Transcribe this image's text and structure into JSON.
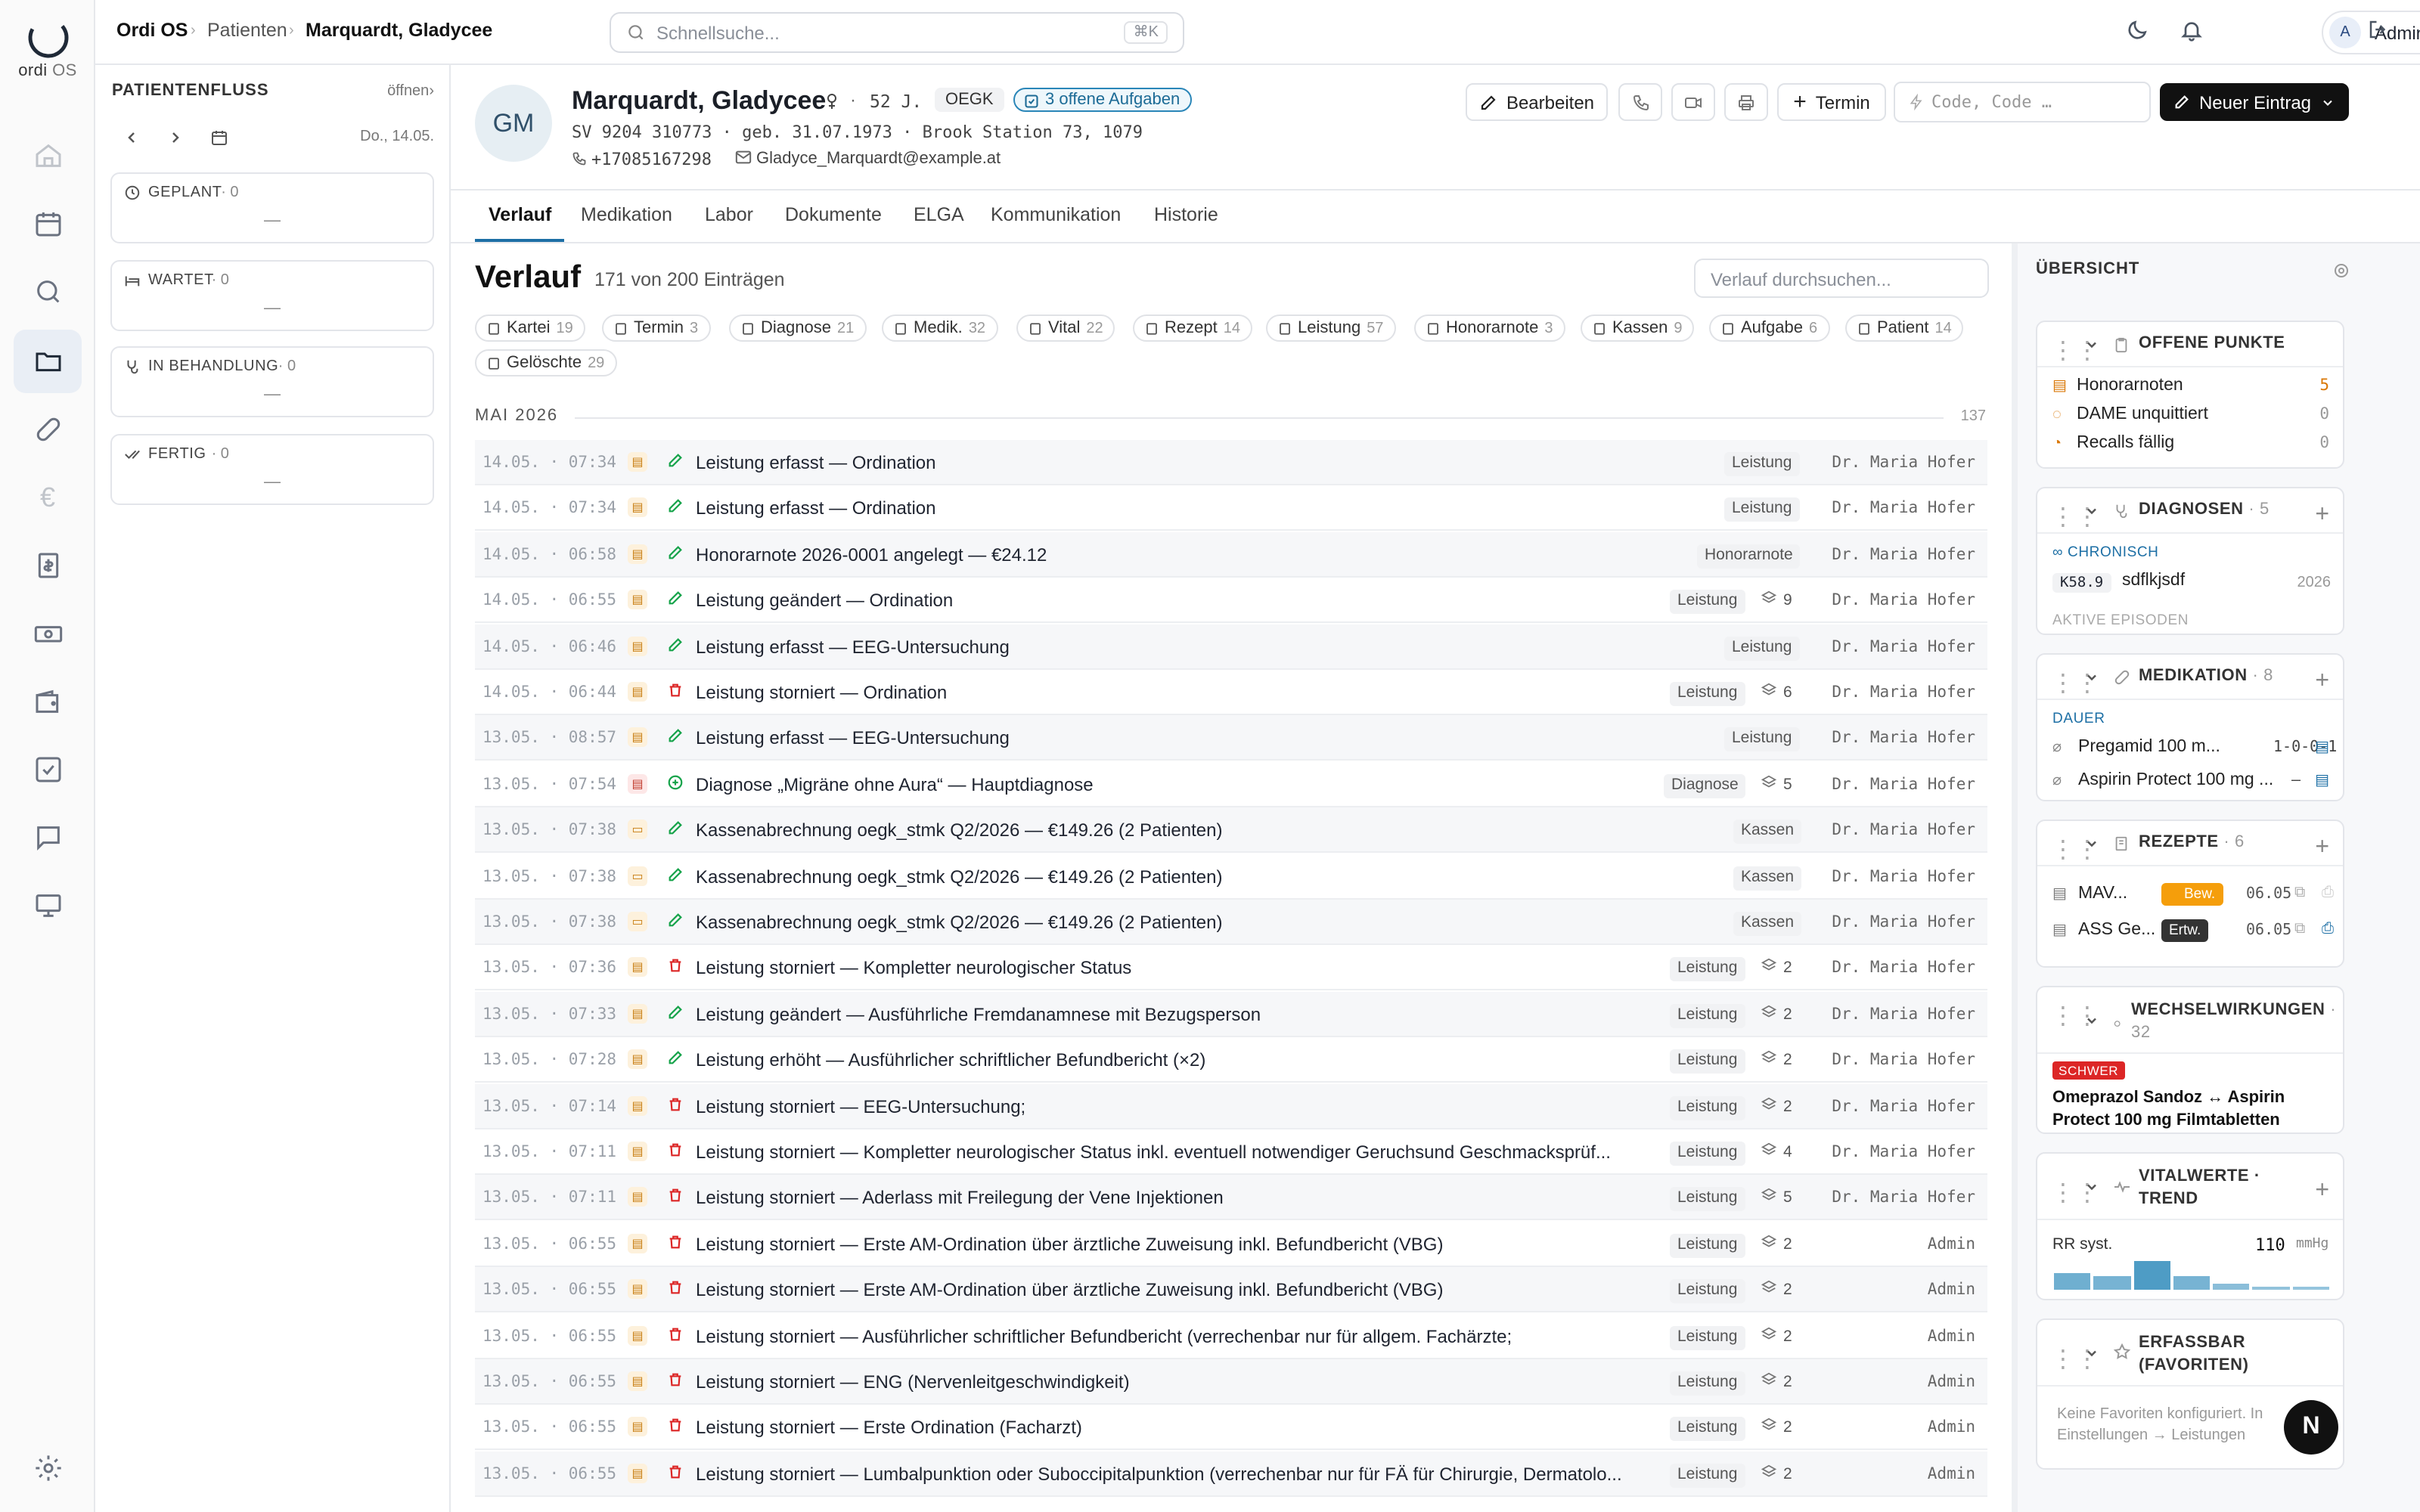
{
  "app": {
    "brand_top": "ordi",
    "brand_bottom": "OS"
  },
  "breadcrumb": {
    "root": "Ordi OS",
    "section": "Patienten",
    "current": "Marquardt, Gladycee"
  },
  "search": {
    "placeholder": "Schnellsuche...",
    "shortcut": "⌘K"
  },
  "user": {
    "initial": "A",
    "name": "Admin"
  },
  "flow": {
    "title": "PATIENTENFLUSS",
    "open_label": "öffnen",
    "date": "Do., 14.05.",
    "groups": [
      {
        "label": "GEPLANT",
        "count": "· 0",
        "empty": "—",
        "icon": "clock-icon"
      },
      {
        "label": "WARTET",
        "count": "· 0",
        "empty": "—",
        "icon": "bed-icon"
      },
      {
        "label": "IN BEHANDLUNG",
        "count": "· 0",
        "empty": "—",
        "icon": "stethoscope-icon"
      },
      {
        "label": "FERTIG",
        "count": "· 0",
        "empty": "—",
        "icon": "check-double-icon"
      }
    ]
  },
  "patient": {
    "initials": "GM",
    "name": "Marquardt, Gladycee",
    "age": "52 J.",
    "insurance": "OEGK",
    "tasks": "3 offene Aufgaben",
    "meta": "SV 9204 310773 · geb. 31.07.1973 · Brook Station 73, 1079",
    "phone": "+17085167298",
    "email": "Gladyce_Marquardt@example.at"
  },
  "actions": {
    "edit": "Bearbeiten",
    "appointment": "Termin",
    "code_placeholder": "Code, Code …",
    "new_entry": "Neuer Eintrag"
  },
  "tabs": [
    "Verlauf",
    "Medikation",
    "Labor",
    "Dokumente",
    "ELGA",
    "Kommunikation",
    "Historie"
  ],
  "verlauf": {
    "title": "Verlauf",
    "count": "171 von 200 Einträgen",
    "search_placeholder": "Verlauf durchsuchen...",
    "filters": [
      {
        "label": "Kartei",
        "n": "19"
      },
      {
        "label": "Termin",
        "n": "3"
      },
      {
        "label": "Diagnose",
        "n": "21"
      },
      {
        "label": "Medik.",
        "n": "32"
      },
      {
        "label": "Vital",
        "n": "22"
      },
      {
        "label": "Rezept",
        "n": "14"
      },
      {
        "label": "Leistung",
        "n": "57"
      },
      {
        "label": "Honorarnote",
        "n": "3"
      },
      {
        "label": "Kassen",
        "n": "9"
      },
      {
        "label": "Aufgabe",
        "n": "6"
      },
      {
        "label": "Patient",
        "n": "14"
      },
      {
        "label": "Gelöschte",
        "n": "29"
      }
    ],
    "month": "MAI 2026",
    "month_count": "137",
    "rows": [
      {
        "ts": "14.05. · 07:34",
        "text": "Leistung erfasst — Ordination",
        "cat": "Leistung",
        "layers": "",
        "by": "Dr. Maria Hofer",
        "type": "leistung",
        "action": "edit"
      },
      {
        "ts": "14.05. · 07:34",
        "text": "Leistung erfasst — Ordination",
        "cat": "Leistung",
        "layers": "",
        "by": "Dr. Maria Hofer",
        "type": "leistung",
        "action": "edit"
      },
      {
        "ts": "14.05. · 06:58",
        "text": "Honorarnote 2026-0001 angelegt — €24.12",
        "cat": "Honorarnote",
        "layers": "",
        "by": "Dr. Maria Hofer",
        "type": "leistung",
        "action": "edit"
      },
      {
        "ts": "14.05. · 06:55",
        "text": "Leistung geändert — Ordination",
        "cat": "Leistung",
        "layers": "9",
        "by": "Dr. Maria Hofer",
        "type": "leistung",
        "action": "edit"
      },
      {
        "ts": "14.05. · 06:46",
        "text": "Leistung erfasst — EEG-Untersuchung",
        "cat": "Leistung",
        "layers": "",
        "by": "Dr. Maria Hofer",
        "type": "leistung",
        "action": "edit"
      },
      {
        "ts": "14.05. · 06:44",
        "text": "Leistung storniert — Ordination",
        "cat": "Leistung",
        "layers": "6",
        "by": "Dr. Maria Hofer",
        "type": "leistung",
        "action": "delete"
      },
      {
        "ts": "13.05. · 08:57",
        "text": "Leistung erfasst — EEG-Untersuchung",
        "cat": "Leistung",
        "layers": "",
        "by": "Dr. Maria Hofer",
        "type": "leistung",
        "action": "edit"
      },
      {
        "ts": "13.05. · 07:54",
        "text": "Diagnose „Migräne ohne Aura“ — Hauptdiagnose",
        "cat": "Diagnose",
        "layers": "5",
        "by": "Dr. Maria Hofer",
        "type": "diagnose",
        "action": "add"
      },
      {
        "ts": "13.05. · 07:38",
        "text": "Kassenabrechnung oegk_stmk Q2/2026 — €149.26 (2 Patienten)",
        "cat": "Kassen",
        "layers": "",
        "by": "Dr. Maria Hofer",
        "type": "kassen",
        "action": "edit"
      },
      {
        "ts": "13.05. · 07:38",
        "text": "Kassenabrechnung oegk_stmk Q2/2026 — €149.26 (2 Patienten)",
        "cat": "Kassen",
        "layers": "",
        "by": "Dr. Maria Hofer",
        "type": "kassen",
        "action": "edit"
      },
      {
        "ts": "13.05. · 07:38",
        "text": "Kassenabrechnung oegk_stmk Q2/2026 — €149.26 (2 Patienten)",
        "cat": "Kassen",
        "layers": "",
        "by": "Dr. Maria Hofer",
        "type": "kassen",
        "action": "edit"
      },
      {
        "ts": "13.05. · 07:36",
        "text": "Leistung storniert — Kompletter neurologischer Status",
        "cat": "Leistung",
        "layers": "2",
        "by": "Dr. Maria Hofer",
        "type": "leistung",
        "action": "delete"
      },
      {
        "ts": "13.05. · 07:33",
        "text": "Leistung geändert — Ausführliche Fremdanamnese mit Bezugsperson",
        "cat": "Leistung",
        "layers": "2",
        "by": "Dr. Maria Hofer",
        "type": "leistung",
        "action": "edit"
      },
      {
        "ts": "13.05. · 07:28",
        "text": "Leistung erhöht — Ausführlicher schriftlicher Befundbericht (×2)",
        "cat": "Leistung",
        "layers": "2",
        "by": "Dr. Maria Hofer",
        "type": "leistung",
        "action": "edit"
      },
      {
        "ts": "13.05. · 07:14",
        "text": "Leistung storniert — EEG-Untersuchung;",
        "cat": "Leistung",
        "layers": "2",
        "by": "Dr. Maria Hofer",
        "type": "leistung",
        "action": "delete"
      },
      {
        "ts": "13.05. · 07:11",
        "text": "Leistung storniert — Kompletter neurologischer Status inkl. eventuell notwendiger Geruchsund Geschmacksprüf...",
        "cat": "Leistung",
        "layers": "4",
        "by": "Dr. Maria Hofer",
        "type": "leistung",
        "action": "delete"
      },
      {
        "ts": "13.05. · 07:11",
        "text": "Leistung storniert — Aderlass mit Freilegung der Vene Injektionen",
        "cat": "Leistung",
        "layers": "5",
        "by": "Dr. Maria Hofer",
        "type": "leistung",
        "action": "delete"
      },
      {
        "ts": "13.05. · 06:55",
        "text": "Leistung storniert — Erste AM-Ordination über ärztliche Zuweisung inkl. Befundbericht (VBG)",
        "cat": "Leistung",
        "layers": "2",
        "by": "Admin",
        "type": "leistung",
        "action": "delete"
      },
      {
        "ts": "13.05. · 06:55",
        "text": "Leistung storniert — Erste AM-Ordination über ärztliche Zuweisung inkl. Befundbericht (VBG)",
        "cat": "Leistung",
        "layers": "2",
        "by": "Admin",
        "type": "leistung",
        "action": "delete"
      },
      {
        "ts": "13.05. · 06:55",
        "text": "Leistung storniert — Ausführlicher schriftlicher Befundbericht (verrechenbar nur für allgem. Fachärzte;",
        "cat": "Leistung",
        "layers": "2",
        "by": "Admin",
        "type": "leistung",
        "action": "delete"
      },
      {
        "ts": "13.05. · 06:55",
        "text": "Leistung storniert — ENG (Nervenleitgeschwindigkeit)",
        "cat": "Leistung",
        "layers": "2",
        "by": "Admin",
        "type": "leistung",
        "action": "delete"
      },
      {
        "ts": "13.05. · 06:55",
        "text": "Leistung storniert — Erste Ordination (Facharzt)",
        "cat": "Leistung",
        "layers": "2",
        "by": "Admin",
        "type": "leistung",
        "action": "delete"
      },
      {
        "ts": "13.05. · 06:55",
        "text": "Leistung storniert — Lumbalpunktion oder Suboccipitalpunktion (verrechenbar nur für FÄ für Chirurgie, Dermatolo...",
        "cat": "Leistung",
        "layers": "2",
        "by": "Admin",
        "type": "leistung",
        "action": "delete"
      }
    ]
  },
  "overview": {
    "title": "ÜBERSICHT",
    "open_items": {
      "title": "OFFENE PUNKTE",
      "items": [
        {
          "label": "Honorarnoten",
          "n": "5",
          "color": "#d97706"
        },
        {
          "label": "DAME unquittiert",
          "n": "0",
          "color": "#999999"
        },
        {
          "label": "Recalls fällig",
          "n": "0",
          "color": "#999999"
        }
      ]
    },
    "diagnoses": {
      "title": "DIAGNOSEN",
      "count": "· 5",
      "chronic": "CHRONISCH",
      "code": "K58.9",
      "name": "sdflkjsdf",
      "year": "2026",
      "active": "AKTIVE EPISODEN"
    },
    "medication": {
      "title": "MEDIKATION",
      "count": "· 8",
      "group": "DAUER",
      "items": [
        {
          "name": "Pregamid 100 m...",
          "dose": "1-0-0-1"
        },
        {
          "name": "Aspirin Protect 100 mg ...",
          "dose": "–"
        }
      ]
    },
    "prescriptions": {
      "title": "REZEPTE",
      "count": "· 6",
      "items": [
        {
          "name": "MAV...",
          "badge": "Bew.",
          "date": "06.05"
        },
        {
          "name": "ASS Ge...",
          "badge": "Ertw.",
          "date": "06.05"
        }
      ]
    },
    "interactions": {
      "title": "WECHSELWIRKUNGEN",
      "count": "· 32",
      "severity": "SCHWER",
      "text": "Omeprazol Sandoz ↔ Aspirin Protect 100 mg Filmtabletten"
    },
    "vitals": {
      "title": "VITALWERTE · TREND",
      "label": "RR syst.",
      "value": "110",
      "unit": "mmHg",
      "trend": [
        0.55,
        0.45,
        0.95,
        0.45,
        0.2,
        0.12,
        0.08
      ]
    },
    "favorites": {
      "title": "ERFASSBAR (FAVORITEN)",
      "empty": "Keine Favoriten konfiguriert. In Einstellungen → Leistungen"
    }
  },
  "fab": "N"
}
